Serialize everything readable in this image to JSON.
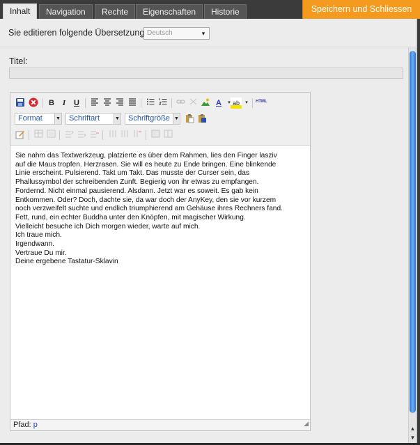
{
  "tabs": [
    {
      "label": "Inhalt",
      "active": true
    },
    {
      "label": "Navigation",
      "active": false
    },
    {
      "label": "Rechte",
      "active": false
    },
    {
      "label": "Eigenschaften",
      "active": false
    },
    {
      "label": "Historie",
      "active": false
    }
  ],
  "save_button": "Speichern und Schliessen",
  "language_row": {
    "label": "Sie editieren folgende Übersetzung:",
    "selected": "Deutsch"
  },
  "title_field": {
    "label": "Titel:",
    "value": ""
  },
  "toolbar": {
    "format_label": "Format",
    "font_label": "Schriftart",
    "size_label": "Schriftgröße",
    "html_label": "HTML",
    "icons_row1": [
      "save-icon",
      "cancel-icon",
      "bold-icon",
      "italic-icon",
      "underline-icon",
      "align-left-icon",
      "align-center-icon",
      "align-right-icon",
      "align-justify-icon",
      "unordered-list-icon",
      "ordered-list-icon",
      "link-icon",
      "unlink-icon",
      "image-icon",
      "text-color-icon",
      "highlight-color-icon",
      "html-source-icon"
    ],
    "icons_row2": [
      "paste-icon",
      "paste-word-icon"
    ],
    "icons_row3": [
      "edit-icon",
      "table-icon",
      "table-props-icon",
      "row-before-icon",
      "row-after-icon",
      "row-delete-icon",
      "col-before-icon",
      "col-after-icon",
      "col-delete-icon",
      "merge-cells-icon",
      "split-cells-icon"
    ]
  },
  "glyphs": {
    "bold": "B",
    "italic": "I",
    "underline": "U",
    "text_color": "A",
    "highlight": "ab",
    "scroll_up": "▲",
    "scroll_down": "▼"
  },
  "content_lines": [
    "Sie nahm das Textwerkzeug, platzierte es über dem Rahmen, lies den Finger lasziv",
    "auf die Maus tropfen. Herzrasen. Sie will es heute zu Ende bringen. Eine blinkende",
    "Linie erscheint. Pulsierend. Takt um Takt. Das musste der Curser sein, das",
    "Phallussymbol der schreibenden Zunft. Begierig von ihr etwas zu empfangen.",
    "Fordernd. Nicht einmal pausierend. Alsdann. Jetzt war es soweit. Es gab kein",
    "Entkommen. Oder? Doch, dachte sie, da war doch der AnyKey, den sie vor kurzem",
    "noch verzweifelt suchte und endlich triumphierend am Gehäuse ihres Rechners fand.",
    "Fett, rund, ein echter Buddha unter den Knöpfen, mit magischer Wirkung.",
    "Vielleicht besuche ich Dich morgen wieder, warte auf mich.",
    "Ich traue mich.",
    "Irgendwann.",
    "Vertraue Du mir.",
    "Deine ergebene Tastatur-Sklavin"
  ],
  "status": {
    "path_label": "Pfad:",
    "path_value": "p"
  },
  "colors": {
    "save_button": "#f39a1f",
    "scrollbar": "#2e74c9",
    "tab_bar": "#3b3b3b",
    "panel": "#ececec"
  }
}
